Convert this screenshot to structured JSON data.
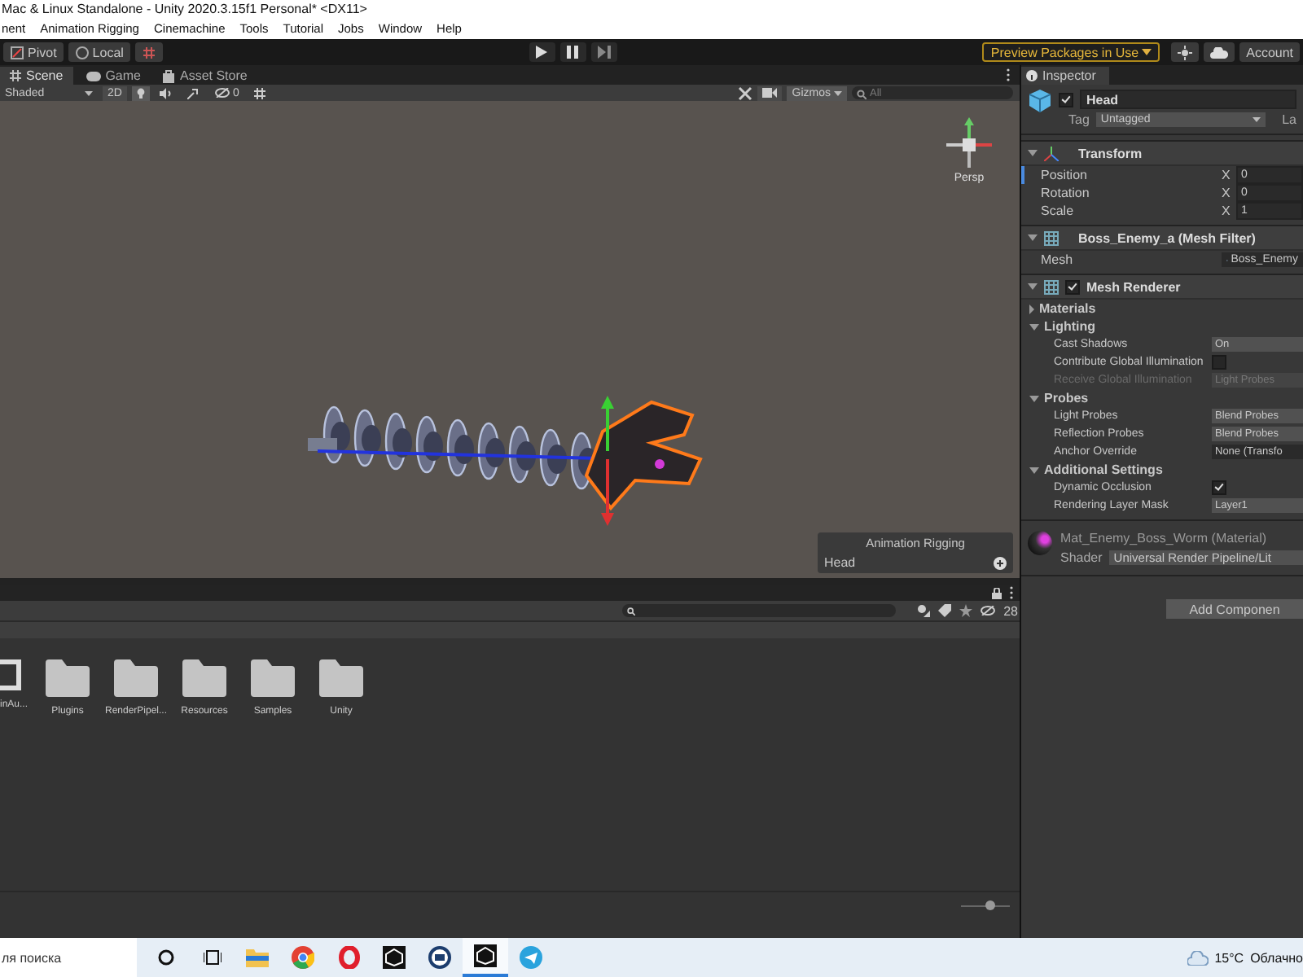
{
  "window": {
    "title": "Mac & Linux Standalone - Unity 2020.3.15f1 Personal* <DX11>"
  },
  "menu": [
    "nent",
    "Animation Rigging",
    "Cinemachine",
    "Tools",
    "Tutorial",
    "Jobs",
    "Window",
    "Help"
  ],
  "toolbar": {
    "pivot": "Pivot",
    "local": "Local",
    "preview_packages": "Preview Packages in Use",
    "account": "Account"
  },
  "tabs": [
    {
      "label": "Scene",
      "selected": true,
      "kind": "scene"
    },
    {
      "label": "Game",
      "selected": false,
      "kind": "game"
    },
    {
      "label": "Asset Store",
      "selected": false,
      "kind": "store"
    }
  ],
  "scene_toolbar": {
    "shading": "Shaded",
    "mode_2d": "2D",
    "toggles": [
      {
        "kind": "lighting",
        "on": true
      },
      {
        "kind": "audio",
        "on": false
      },
      {
        "kind": "effects",
        "on": false
      },
      {
        "kind": "hidden",
        "on": false,
        "count": "0"
      },
      {
        "kind": "grid",
        "on": false
      }
    ],
    "gizmos": "Gizmos",
    "search": {
      "placeholder": "All"
    }
  },
  "scene": {
    "view_label": "Persp",
    "overlay": {
      "title": "Animation Rigging",
      "item": "Head"
    }
  },
  "project": {
    "hidden_count": "28",
    "folders": [
      {
        "name": "inAu...",
        "kind": "asset"
      },
      {
        "name": "Plugins",
        "kind": "folder"
      },
      {
        "name": "RenderPipel...",
        "kind": "folder"
      },
      {
        "name": "Resources",
        "kind": "folder"
      },
      {
        "name": "Samples",
        "kind": "folder"
      },
      {
        "name": "Unity",
        "kind": "folder"
      }
    ],
    "zoom_slider": {
      "level": 0.6
    }
  },
  "inspector": {
    "tab": "Inspector",
    "object": {
      "name": "Head",
      "active": true,
      "tag_label": "Tag",
      "tag": "Untagged",
      "layer_label": "La"
    },
    "components": [
      {
        "title": "Transform",
        "kind": "transform",
        "expanded": true,
        "rows": [
          {
            "kind": "vector",
            "label": "Position",
            "axis": "X",
            "value": "0",
            "selected": true
          },
          {
            "kind": "vector",
            "label": "Rotation",
            "axis": "X",
            "value": "0",
            "selected": false
          },
          {
            "kind": "vector",
            "label": "Scale",
            "axis": "X",
            "value": "1",
            "selected": false
          }
        ]
      },
      {
        "title": "Boss_Enemy_a (Mesh Filter)",
        "kind": "mesh_filter",
        "expanded": true,
        "rows": [
          {
            "kind": "object",
            "label": "Mesh",
            "value": "Boss_Enemy"
          }
        ]
      },
      {
        "title": "Mesh Renderer",
        "kind": "mesh_renderer",
        "expanded": true,
        "enabled": true,
        "rows": [
          {
            "kind": "group",
            "label": "Materials",
            "expanded": false,
            "rows": []
          },
          {
            "kind": "group",
            "label": "Lighting",
            "expanded": true,
            "rows": [
              {
                "kind": "dropdown",
                "label": "Cast Shadows",
                "value": "On",
                "disabled": false
              },
              {
                "kind": "checkbox",
                "label": "Contribute Global Illumination",
                "checked": false
              },
              {
                "kind": "dropdown",
                "label": "Receive Global Illumination",
                "value": "Light Probes",
                "disabled": true
              }
            ]
          },
          {
            "kind": "group",
            "label": "Probes",
            "expanded": true,
            "rows": [
              {
                "kind": "dropdown",
                "label": "Light Probes",
                "value": "Blend Probes",
                "disabled": false
              },
              {
                "kind": "dropdown",
                "label": "Reflection Probes",
                "value": "Blend Probes",
                "disabled": false
              },
              {
                "kind": "object",
                "label": "Anchor Override",
                "value": "None (Transfo"
              }
            ]
          },
          {
            "kind": "group",
            "label": "Additional Settings",
            "expanded": true,
            "rows": [
              {
                "kind": "checkbox",
                "label": "Dynamic Occlusion",
                "checked": true
              },
              {
                "kind": "dropdown",
                "label": "Rendering Layer Mask",
                "value": "Layer1",
                "disabled": false
              }
            ]
          }
        ]
      }
    ],
    "material": {
      "name": "Mat_Enemy_Boss_Worm (Material)",
      "shader_label": "Shader",
      "shader": "Universal Render Pipeline/Lit"
    },
    "add_button": "Add Componen"
  },
  "taskbar": {
    "search": {
      "placeholder": "ля поиска"
    },
    "apps": [
      {
        "kind": "cortana",
        "selected": false
      },
      {
        "kind": "taskview",
        "selected": false
      },
      {
        "kind": "explorer",
        "selected": false
      },
      {
        "kind": "chrome",
        "selected": false
      },
      {
        "kind": "opera",
        "selected": false
      },
      {
        "kind": "unity",
        "selected": false
      },
      {
        "kind": "vr",
        "selected": false
      },
      {
        "kind": "unity",
        "selected": true
      },
      {
        "kind": "telegram",
        "selected": false
      }
    ],
    "temperature": "15°C",
    "weather": "Облачно"
  }
}
